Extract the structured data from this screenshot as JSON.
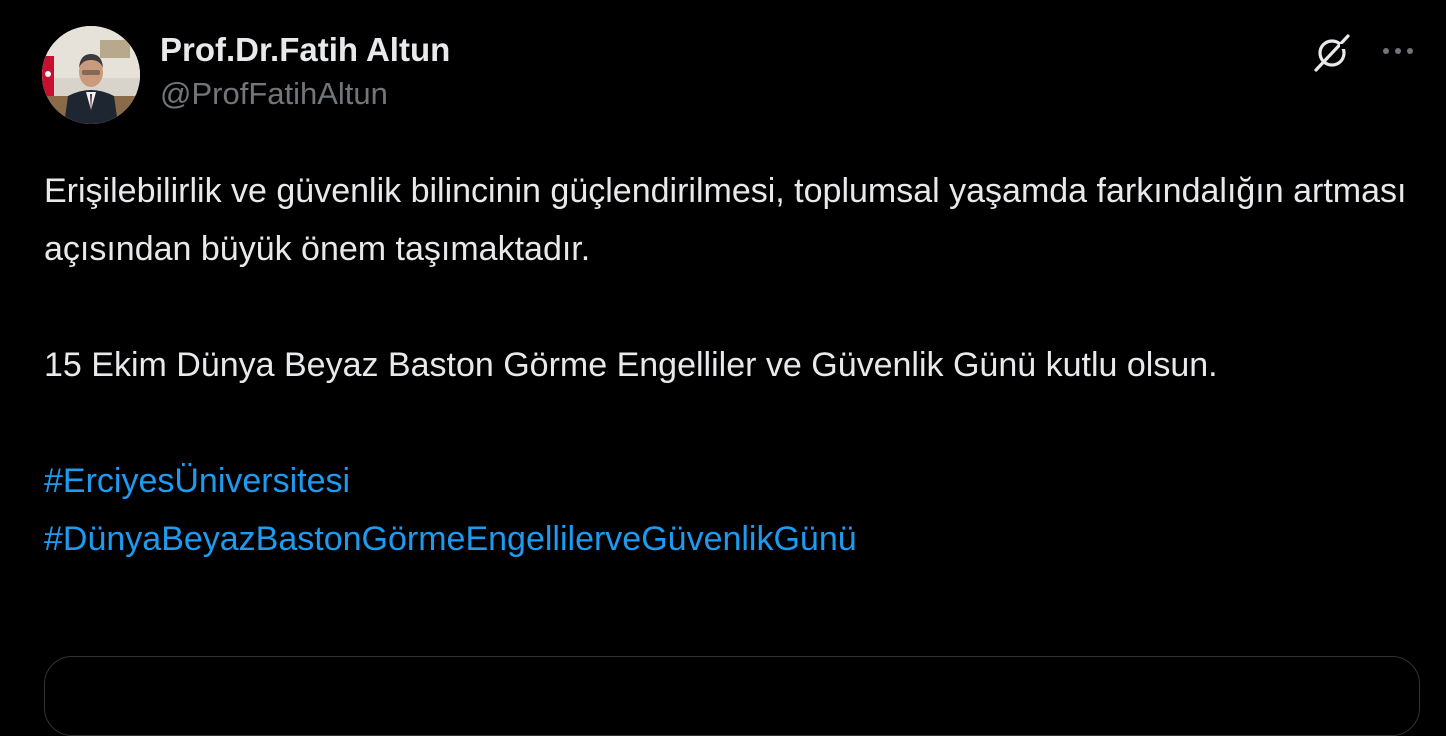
{
  "author": {
    "display_name": "Prof.Dr.Fatih Altun",
    "handle": "@ProfFatihAltun"
  },
  "header_icons": [
    "grok-icon",
    "more-icon"
  ],
  "tweet": {
    "paragraph_1": "Erişilebilirlik ve güvenlik bilincinin güçlendirilmesi, toplumsal yaşamda farkındalığın artması açısından büyük önem taşımaktadır.",
    "paragraph_2": "15 Ekim Dünya Beyaz Baston Görme Engelliler ve Güvenlik Günü kutlu olsun.",
    "hashtags": [
      "#ErciyesÜniversitesi",
      "#DünyaBeyazBastonGörmeEngellilerveGüvenlikGünü"
    ]
  },
  "colors": {
    "background": "#000000",
    "text": "#e7e9ea",
    "secondary_text": "#71767b",
    "link": "#1d9bf0",
    "border": "#2f3336"
  }
}
